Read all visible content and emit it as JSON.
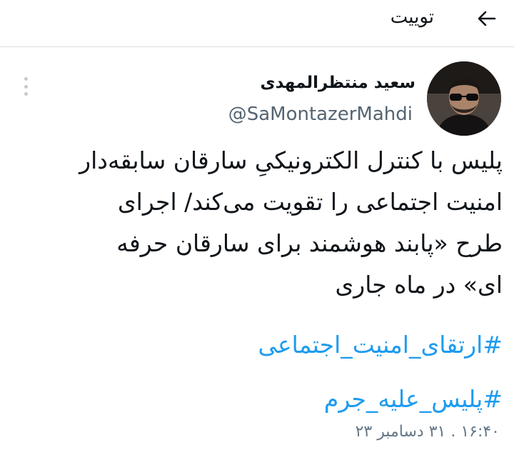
{
  "header": {
    "title": "توییت",
    "back_icon": "arrow-left-icon"
  },
  "author": {
    "display_name": "سعید منتظرالمهدی",
    "handle": "@SaMontazerMahdi",
    "avatar_icon": "user-avatar"
  },
  "tweet": {
    "lines": [
      "پلیس با کنترل الکترونیکیِ سارقان سابقه‌دار",
      "امنیت اجتماعی را تقویت می‌کند/ اجرای",
      "طرح «پابند هوشمند برای سارقان حرفه",
      "ای» در ماه جاری"
    ],
    "hashtags": [
      "#ارتقای_امنیت_اجتماعی",
      "#پلیس_علیه_جرم"
    ],
    "timestamp": "۱۶:۴۰ . ۳۱ دسامبر ۲۳"
  },
  "colors": {
    "accent": "#1d9bf0",
    "secondary_text": "#546471",
    "divider": "#d6dce0"
  }
}
